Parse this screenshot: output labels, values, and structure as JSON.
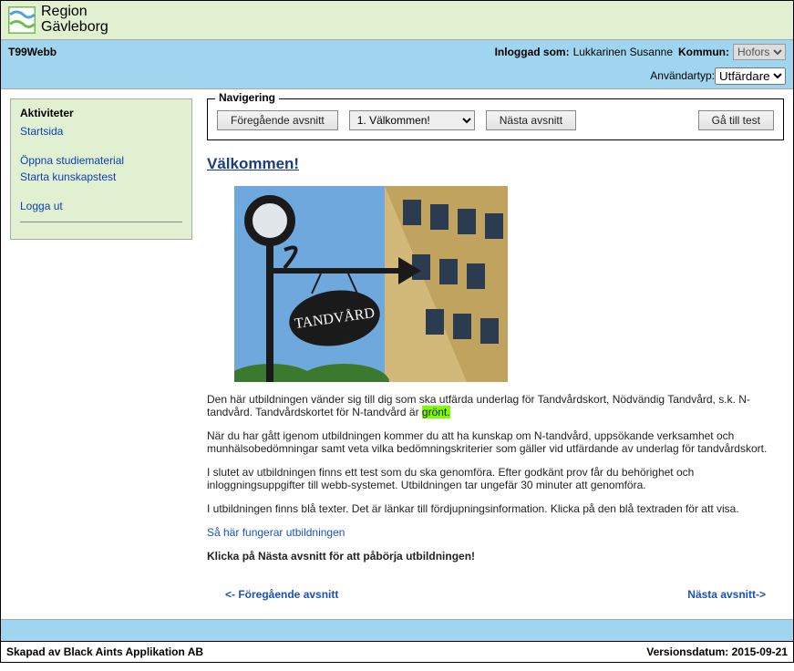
{
  "brand": {
    "line1": "Region",
    "line2": "Gävleborg"
  },
  "topbar": {
    "appname": "T99Webb",
    "logged_in_label": "Inloggad som:",
    "username": "Lukkarinen Susanne",
    "kommun_label": "Kommun:",
    "kommun_value": "Hofors",
    "usertype_label": "Användartyp:",
    "usertype_value": "Utfärdare"
  },
  "sidebar": {
    "title": "Aktiviteter",
    "links": {
      "start": "Startsida",
      "open_study": "Öppna studiematerial",
      "start_test": "Starta kunskapstest",
      "logout": "Logga ut"
    }
  },
  "nav": {
    "legend": "Navigering",
    "prev": "Föregående avsnitt",
    "section_value": "1. Välkommen!",
    "next": "Nästa avsnitt",
    "goto_test": "Gå till test"
  },
  "content": {
    "title": "Välkommen!",
    "sign_text": "TANDVÅRD",
    "p1a": "Den här utbildningen vänder sig till dig som ska utfärda underlag för Tandvårdskort, Nödvändig Tandvård,  s.k. N-tandvård. Tandvårdskortet för N-tandvård är ",
    "p1b": "grönt.",
    "p2": "När du har gått igenom utbildningen kommer du att ha kunskap om N-tandvård, uppsökande verksamhet och munhälsobedömningar samt veta vilka bedömningskriterier som gäller vid utfärdande av underlag för tandvårdskort.",
    "p3": "I slutet av utbildningen finns ett test som du ska genomföra. Efter godkänt prov får du behörighet och inloggningsuppgifter till webb-systemet. Utbildningen tar ungefär 30 minuter att genomföra.",
    "p4": "I utbildningen finns blå texter. Det är länkar till fördjupningsinformation. Klicka på den blå textraden för att visa.",
    "link_howitworks": "Så här fungerar utbildningen",
    "p5": "Klicka på Nästa avsnitt för att påbörja utbildningen!",
    "bottom_prev": "<- Föregående avsnitt",
    "bottom_next": "Nästa avsnitt->"
  },
  "footer": {
    "left": "Skapad av Black Aints Applikation AB",
    "right": "Versionsdatum: 2015-09-21"
  }
}
